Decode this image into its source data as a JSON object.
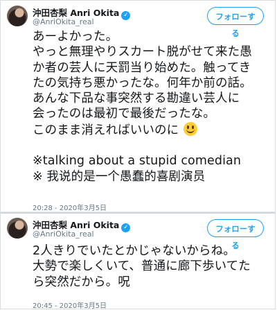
{
  "tweets": [
    {
      "display_name": "沖田杏梨 Anri Okita",
      "handle": "@AnriOkita_real",
      "follow_label": "フォローする",
      "text": "あーよかった。\nやっと無理やりスカート脱がせて来た愚\nか者の芸人に天罰当り始めた。触ってき\nたの気持ち悪かったな。何年か前の話。\nあんな下品な事突然する勘違い芸人に\n会ったのは最初で最後だったな。\nこのまま消えればいいのに",
      "text_extra": "\n\n※talking about a stupid comedian\n※ 我说的是一个愚蠢的喜剧演员",
      "timestamp": "20:28 - 2020年3月5日"
    },
    {
      "display_name": "沖田杏梨 Anri Okita",
      "handle": "@AnriOkita_real",
      "follow_label": "フォローする",
      "text": "2人きりでいたとかじゃないからね。\n大勢で楽しくいて、普通に廊下歩いてた\nら突然だから。呪",
      "timestamp": "20:45 - 2020年3月5日"
    }
  ],
  "colors": {
    "accent": "#1da1f2",
    "meta_text": "#657786",
    "emoji": "#ffcc33"
  },
  "icons": {
    "verified": "verified-badge-icon",
    "emoji": "smiling-face-emoji"
  }
}
